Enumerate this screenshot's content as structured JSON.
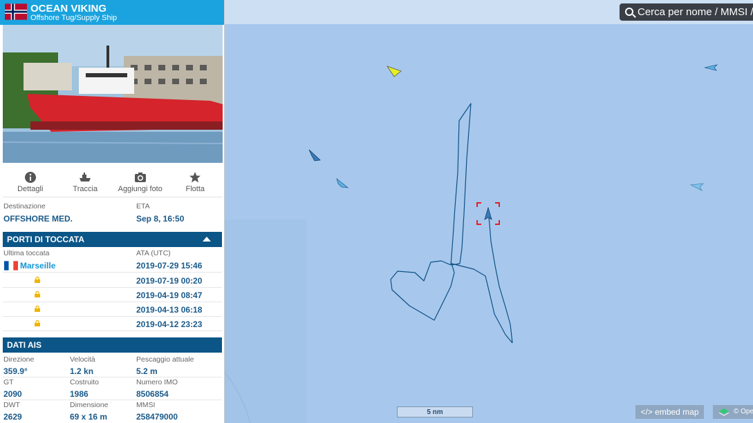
{
  "ship": {
    "name": "OCEAN VIKING",
    "type": "Offshore Tug/Supply Ship"
  },
  "actions": [
    {
      "label": "Dettagli",
      "icon": "info-icon"
    },
    {
      "label": "Traccia",
      "icon": "ship-track-icon"
    },
    {
      "label": "Aggiungi foto",
      "icon": "camera-icon"
    },
    {
      "label": "Flotta",
      "icon": "star-icon"
    }
  ],
  "voyage": {
    "destination_label": "Destinazione",
    "destination": "OFFSHORE MED.",
    "eta_label": "ETA",
    "eta": "Sep 8, 16:50"
  },
  "ports": {
    "title": "PORTI DI TOCCATA",
    "last_label": "Ultima toccata",
    "ata_label": "ATA (UTC)",
    "last_port": "Marseille",
    "times": [
      "2019-07-29 15:46",
      "2019-07-19 00:20",
      "2019-04-19 08:47",
      "2019-04-13 06:18",
      "2019-04-12 23:23"
    ]
  },
  "ais": {
    "title": "DATI AIS",
    "course_label": "Direzione",
    "course": "359.9°",
    "speed_label": "Velocità",
    "speed": "1.2 kn",
    "draught_label": "Pescaggio attuale",
    "draught": "5.2 m",
    "gt_label": "GT",
    "gt": "2090",
    "built_label": "Costruito",
    "built": "1986",
    "imo_label": "Numero IMO",
    "imo": "8506854",
    "dwt_label": "DWT",
    "dwt": "2629",
    "size_label": "Dimensione",
    "size": "69 x 16 m",
    "mmsi_label": "MMSI",
    "mmsi": "258479000"
  },
  "map": {
    "search_placeholder": "Cerca per nome / MMSI / IMO",
    "scale_label": "5 nm",
    "embed_label": "</> embed map",
    "attribution": "© OpenSeaMap",
    "water_color": "#a7c8ec",
    "track_color": "#0d4f86",
    "target_color": "#e31e24"
  },
  "colors": {
    "header": "#1aa3de",
    "section": "#0b5587",
    "value_text": "#1a5a8a"
  }
}
